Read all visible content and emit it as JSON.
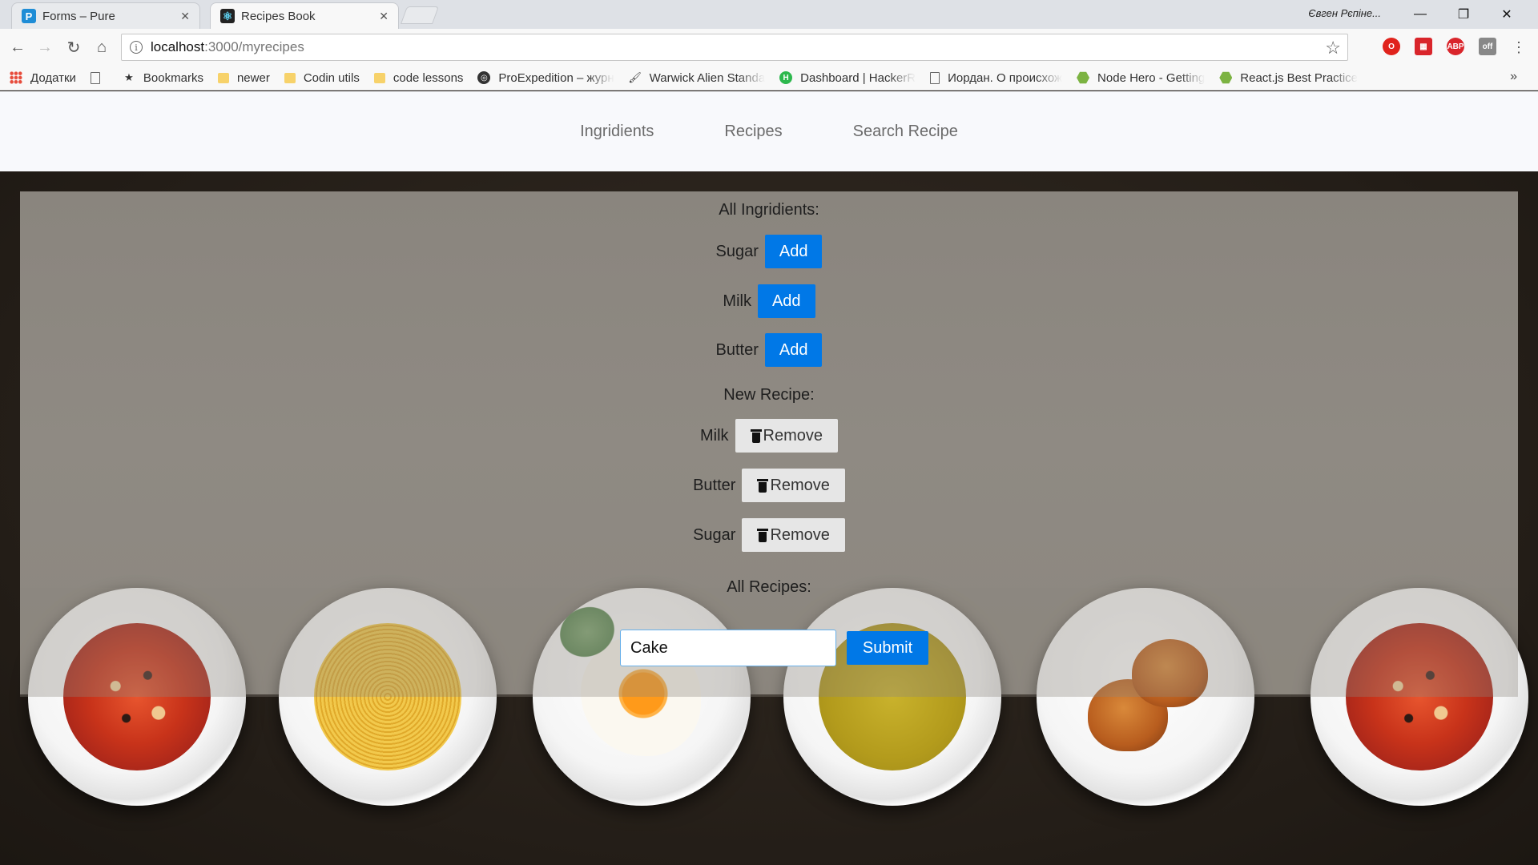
{
  "browser": {
    "tabs": [
      {
        "title": "Forms – Pure",
        "icon": "P"
      },
      {
        "title": "Recipes Book",
        "icon": "⚛"
      }
    ],
    "profile_name": "Євген Рєпіне...",
    "url_host": "localhost",
    "url_path": ":3000/myrecipes",
    "bookmarks": [
      "Додатки",
      "Bookmarks",
      "newer",
      "Codin utils",
      "code lessons",
      "ProExpedition – журн",
      "Warwick Alien Standa",
      "Dashboard | HackerR",
      "Иордан. О происхож",
      "Node Hero - Getting",
      "React.js Best Practice"
    ],
    "extensions": [
      "opera-icon",
      "pocket-icon",
      "adblock-icon",
      "off-extension-icon"
    ],
    "ext_labels": {
      "abp": "ABP",
      "off": "off"
    }
  },
  "nav": {
    "items": [
      "Ingridients",
      "Recipes",
      "Search Recipe"
    ]
  },
  "ingredients": {
    "heading": "All Ingridients:",
    "items": [
      "Sugar",
      "Milk",
      "Butter"
    ],
    "add_label": "Add"
  },
  "new_recipe": {
    "heading": "New Recipe:",
    "items": [
      "Milk",
      "Butter",
      "Sugar"
    ],
    "remove_label": "Remove"
  },
  "recipes": {
    "heading": "All Recipes:",
    "input_value": "Cake",
    "submit_label": "Submit"
  },
  "colors": {
    "primary_button": "#0078e7",
    "remove_button": "#e6e6e6",
    "panel": "#8c877f"
  }
}
